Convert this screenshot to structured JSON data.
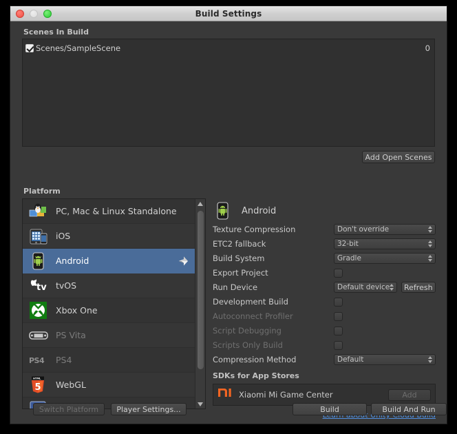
{
  "window": {
    "title": "Build Settings",
    "controls": {
      "close": "close-button",
      "minimize": "minimize-button",
      "zoom": "zoom-button"
    }
  },
  "scenes": {
    "section_label": "Scenes In Build",
    "rows": [
      {
        "name": "Scenes/SampleScene",
        "index": "0",
        "checked": true
      }
    ],
    "add_open_scenes_label": "Add Open Scenes"
  },
  "platform": {
    "section_label": "Platform",
    "items": [
      {
        "label": "PC, Mac & Linux Standalone",
        "icon": "standalone-icon",
        "selected": false,
        "enabled": true
      },
      {
        "label": "iOS",
        "icon": "ios-icon",
        "selected": false,
        "enabled": true
      },
      {
        "label": "Android",
        "icon": "android-icon",
        "selected": true,
        "enabled": true
      },
      {
        "label": "tvOS",
        "icon": "tvos-icon",
        "selected": false,
        "enabled": true
      },
      {
        "label": "Xbox One",
        "icon": "xbox-icon",
        "selected": false,
        "enabled": true
      },
      {
        "label": "PS Vita",
        "icon": "psvita-icon",
        "selected": false,
        "enabled": false
      },
      {
        "label": "PS4",
        "icon": "ps4-icon",
        "selected": false,
        "enabled": false
      },
      {
        "label": "WebGL",
        "icon": "webgl-icon",
        "selected": false,
        "enabled": true
      }
    ],
    "selected_marker": "unity-logo-icon"
  },
  "settings": {
    "header": {
      "title": "Android",
      "icon": "android-icon"
    },
    "rows": [
      {
        "label": "Texture Compression",
        "type": "popup",
        "value": "Don't override",
        "enabled": true
      },
      {
        "label": "ETC2 fallback",
        "type": "popup",
        "value": "32-bit",
        "enabled": true
      },
      {
        "label": "Build System",
        "type": "popup",
        "value": "Gradle",
        "enabled": true
      },
      {
        "label": "Export Project",
        "type": "checkbox",
        "checked": false,
        "enabled": true
      },
      {
        "label": "Run Device",
        "type": "popup-refresh",
        "value": "Default device",
        "button": "Refresh",
        "enabled": true
      },
      {
        "label": "Development Build",
        "type": "checkbox",
        "checked": false,
        "enabled": true
      },
      {
        "label": "Autoconnect Profiler",
        "type": "checkbox",
        "checked": false,
        "enabled": false
      },
      {
        "label": "Script Debugging",
        "type": "checkbox",
        "checked": false,
        "enabled": false
      },
      {
        "label": "Scripts Only Build",
        "type": "checkbox",
        "checked": false,
        "enabled": false
      },
      {
        "label": "Compression Method",
        "type": "popup",
        "value": "Default",
        "enabled": true
      }
    ],
    "sdk": {
      "section_label": "SDKs for App Stores",
      "entries": [
        {
          "name": "Xiaomi Mi Game Center",
          "icon": "xiaomi-icon",
          "button": "Add",
          "button_enabled": false
        }
      ]
    },
    "cloud_build_link": "Learn about Unity Cloud Build"
  },
  "footer": {
    "switch_platform": {
      "label": "Switch Platform",
      "enabled": false
    },
    "player_settings": {
      "label": "Player Settings...",
      "enabled": true
    },
    "build": {
      "label": "Build",
      "enabled": true
    },
    "build_and_run": {
      "label": "Build And Run",
      "enabled": true
    }
  },
  "colors": {
    "window_bg": "#393939",
    "panel_bg": "#303030",
    "selection": "#4a6c99",
    "link": "#4f8fe0",
    "accent_xiaomi": "#f26522",
    "accent_android": "#9fcf4b",
    "titlebar": "#d0d0d0"
  }
}
